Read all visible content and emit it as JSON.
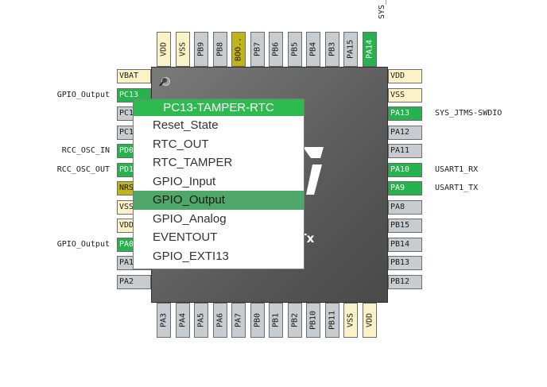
{
  "top_pins": [
    {
      "label": "VDD",
      "color": "yellow"
    },
    {
      "label": "VSS",
      "color": "yellow"
    },
    {
      "label": "PB9",
      "color": "gray"
    },
    {
      "label": "PB8",
      "color": "gray"
    },
    {
      "label": "BOO..",
      "color": "olive"
    },
    {
      "label": "PB7",
      "color": "gray"
    },
    {
      "label": "PB6",
      "color": "gray"
    },
    {
      "label": "PB5",
      "color": "gray"
    },
    {
      "label": "PB4",
      "color": "gray"
    },
    {
      "label": "PB3",
      "color": "gray"
    },
    {
      "label": "PA15",
      "color": "gray"
    },
    {
      "label": "PA14",
      "color": "green"
    }
  ],
  "top_external": "SYS_",
  "left_pins": [
    {
      "label": "VBAT",
      "color": "yellow",
      "ext": ""
    },
    {
      "label": "PC13",
      "color": "green",
      "ext": "GPIO_Output"
    },
    {
      "label": "PC14",
      "color": "gray",
      "ext": ""
    },
    {
      "label": "PC15",
      "color": "gray",
      "ext": ""
    },
    {
      "label": "PD0",
      "color": "green",
      "ext": "RCC_OSC_IN"
    },
    {
      "label": "PD1",
      "color": "green",
      "ext": "RCC_OSC_OUT"
    },
    {
      "label": "NRST",
      "color": "olive",
      "ext": ""
    },
    {
      "label": "VSSA",
      "color": "yellow",
      "ext": ""
    },
    {
      "label": "VDDA",
      "color": "yellow",
      "ext": ""
    },
    {
      "label": "PA0",
      "color": "green",
      "ext": "GPIO_Output"
    },
    {
      "label": "PA1",
      "color": "gray",
      "ext": ""
    },
    {
      "label": "PA2",
      "color": "gray",
      "ext": ""
    }
  ],
  "right_pins": [
    {
      "label": "VDD",
      "color": "yellow",
      "ext": ""
    },
    {
      "label": "VSS",
      "color": "yellow",
      "ext": ""
    },
    {
      "label": "PA13",
      "color": "green",
      "ext": "SYS_JTMS-SWDIO"
    },
    {
      "label": "PA12",
      "color": "gray",
      "ext": ""
    },
    {
      "label": "PA11",
      "color": "gray",
      "ext": ""
    },
    {
      "label": "PA10",
      "color": "green",
      "ext": "USART1_RX"
    },
    {
      "label": "PA9",
      "color": "green",
      "ext": "USART1_TX"
    },
    {
      "label": "PA8",
      "color": "gray",
      "ext": ""
    },
    {
      "label": "PB15",
      "color": "gray",
      "ext": ""
    },
    {
      "label": "PB14",
      "color": "gray",
      "ext": ""
    },
    {
      "label": "PB13",
      "color": "gray",
      "ext": ""
    },
    {
      "label": "PB12",
      "color": "gray",
      "ext": ""
    }
  ],
  "bottom_pins": [
    {
      "label": "PA3",
      "color": "gray"
    },
    {
      "label": "PA4",
      "color": "gray"
    },
    {
      "label": "PA5",
      "color": "gray"
    },
    {
      "label": "PA6",
      "color": "gray"
    },
    {
      "label": "PA7",
      "color": "gray"
    },
    {
      "label": "PB0",
      "color": "gray"
    },
    {
      "label": "PB1",
      "color": "gray"
    },
    {
      "label": "PB2",
      "color": "gray"
    },
    {
      "label": "PB10",
      "color": "gray"
    },
    {
      "label": "PB11",
      "color": "gray"
    },
    {
      "label": "VSS",
      "color": "yellow"
    },
    {
      "label": "VDD",
      "color": "yellow"
    }
  ],
  "chip": {
    "part_suffix": "3Tx"
  },
  "menu": {
    "title": "PC13-TAMPER-RTC",
    "items": [
      "Reset_State",
      "RTC_OUT",
      "RTC_TAMPER",
      "GPIO_Input",
      "GPIO_Output",
      "GPIO_Analog",
      "EVENTOUT",
      "GPIO_EXTI13"
    ],
    "selected": "GPIO_Output"
  },
  "icons": {
    "pin_marker": "pushpin-icon",
    "chip_logo": "st-logo-icon"
  },
  "colors": {
    "assigned": "#26b24c",
    "power": "#fcf2c7",
    "unassigned": "#c7ccd1",
    "reset": "#c1b418",
    "menu_header": "#2dba4e",
    "menu_selected": "#4fa868"
  }
}
